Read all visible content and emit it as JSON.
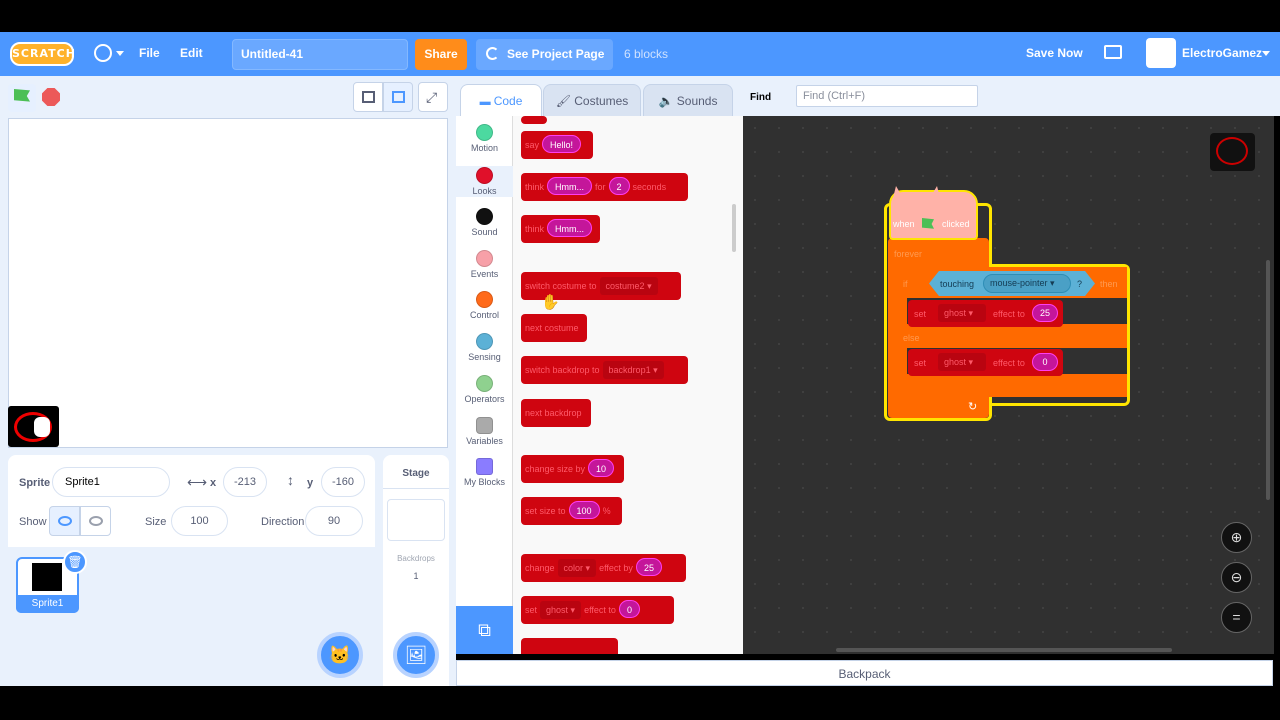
{
  "menu": {
    "logo": "SCRATCH",
    "file": "File",
    "edit": "Edit",
    "project_title": "Untitled-41",
    "share": "Share",
    "see_project_page": "See Project Page",
    "blocks_count": "6 blocks",
    "save_now": "Save Now",
    "username": "ElectroGamez"
  },
  "tabs": {
    "code": "Code",
    "costumes": "Costumes",
    "sounds": "Sounds"
  },
  "find": {
    "label": "Find",
    "placeholder": "Find (Ctrl+F)"
  },
  "categories": [
    {
      "label": "Motion",
      "color": "#4c97ff"
    },
    {
      "label": "Looks",
      "color": "#9966ff"
    },
    {
      "label": "Sound",
      "color": "#cf63cf"
    },
    {
      "label": "Events",
      "color": "#ffbf00"
    },
    {
      "label": "Control",
      "color": "#ffab19"
    },
    {
      "label": "Sensing",
      "color": "#5cb1d6"
    },
    {
      "label": "Operators",
      "color": "#59c059"
    },
    {
      "label": "Variables",
      "color": "#ff8c1a"
    },
    {
      "label": "My Blocks",
      "color": "#ff6680"
    }
  ],
  "palette": {
    "say": {
      "label": "say",
      "value": "Hello!"
    },
    "think_for": {
      "label": "think",
      "value": "Hmm...",
      "for": "for",
      "secs": "2",
      "seconds": "seconds"
    },
    "think": {
      "label": "think",
      "value": "Hmm..."
    },
    "switch_costume": {
      "label": "switch costume to",
      "value": "costume2"
    },
    "next_costume": "next costume",
    "switch_backdrop": {
      "label": "switch backdrop to",
      "value": "backdrop1"
    },
    "next_backdrop": "next backdrop",
    "change_size": {
      "label": "change size by",
      "value": "10"
    },
    "set_size": {
      "label": "set size to",
      "value": "100",
      "unit": "%"
    },
    "change_effect": {
      "label": "change",
      "effect": "color",
      "by": "effect by",
      "value": "25"
    },
    "set_effect": {
      "label": "set",
      "effect": "ghost",
      "to": "effect to",
      "value": "0"
    }
  },
  "script": {
    "when": "when",
    "clicked": "clicked",
    "forever": "forever",
    "if": "if",
    "touching": "touching",
    "target": "mouse-pointer",
    "question": "?",
    "then": "then",
    "set1": {
      "set": "set",
      "effect": "ghost",
      "to": "effect to",
      "value": "25"
    },
    "else": "else",
    "set2": {
      "set": "set",
      "effect": "ghost",
      "to": "effect to",
      "value": "0"
    }
  },
  "sprite_info": {
    "sprite_label": "Sprite",
    "sprite_name": "Sprite1",
    "x_label": "x",
    "x": "-213",
    "y_label": "y",
    "y": "-160",
    "show_label": "Show",
    "size_label": "Size",
    "size": "100",
    "direction_label": "Direction",
    "direction": "90"
  },
  "sprite_list": [
    {
      "name": "Sprite1"
    }
  ],
  "stage_panel": {
    "title": "Stage",
    "backdrops_label": "Backdrops",
    "backdrops_count": "1"
  },
  "backpack": "Backpack"
}
